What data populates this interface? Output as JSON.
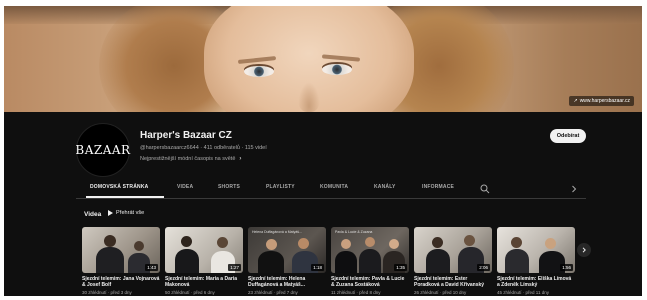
{
  "banner": {
    "link_text": "www.harpersbazaar.cz"
  },
  "channel": {
    "avatar_text": "BAZAAR",
    "name": "Harper's Bazaar CZ",
    "meta": "@harpersbazaarcz6644 · 411 odběratelů · 115 videí",
    "description": "Nejprestižnější módní časopis na světě",
    "subscribe_label": "Odebírat"
  },
  "tabs": [
    {
      "label": "DOMOVSKÁ STRÁNKA",
      "active": true
    },
    {
      "label": "VIDEA",
      "active": false
    },
    {
      "label": "SHORTS",
      "active": false
    },
    {
      "label": "PLAYLISTY",
      "active": false
    },
    {
      "label": "KOMUNITA",
      "active": false
    },
    {
      "label": "KANÁLY",
      "active": false
    },
    {
      "label": "INFORMACE",
      "active": false
    }
  ],
  "section": {
    "title": "Videa",
    "play_all": "Přehrát vše"
  },
  "videos": [
    {
      "title": "Sjezdní telemim: Jana Vojnarová & Josef Bolf",
      "meta": "30 zhlédnutí · před 3 dny",
      "duration": "1:43",
      "caption": ""
    },
    {
      "title": "Sjezdní telemim: Maria a Daria Makonová",
      "meta": "50 zhlédnutí · před 6 dny",
      "duration": "1:27",
      "caption": ""
    },
    {
      "title": "Sjezdní telemim: Helena Duffagánová a Matyáš...",
      "meta": "23 zhlédnutí · před 7 dny",
      "duration": "1:18",
      "caption": "Helena Duffagánová a Matyáš..."
    },
    {
      "title": "Sjezdní telemim: Pavla & Lucie & Zuzana Sostáková",
      "meta": "11 zhlédnutí · před 8 dny",
      "duration": "1:35",
      "caption": "Pavla & Lucie & Zuzana"
    },
    {
      "title": "Sjezdní telemim: Ester Poradková a David Křivanský",
      "meta": "26 zhlédnutí · před 10 dny",
      "duration": "2:06",
      "caption": ""
    },
    {
      "title": "Sjezdní telemim: Eliška Límová a Zdeněk Límský",
      "meta": "45 zhlédnutí · před 11 dny",
      "duration": "1:56",
      "caption": ""
    }
  ],
  "colors": {
    "background": "#0f0f0f",
    "text_primary": "#f1f1f1",
    "text_secondary": "#aaaaaa",
    "subscribe_bg": "#f1f1f1"
  }
}
